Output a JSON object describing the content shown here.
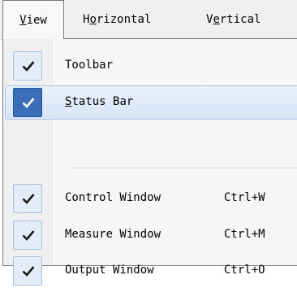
{
  "menubar": {
    "items": [
      {
        "accel": "V",
        "rest": "iew"
      },
      {
        "pre": "H",
        "accel": "o",
        "rest": "rizontal"
      },
      {
        "pre": "V",
        "accel": "e",
        "rest": "rtical"
      }
    ]
  },
  "menu": {
    "items": [
      {
        "label": "Toolbar",
        "checked": true,
        "shortcut": ""
      },
      {
        "accel": "S",
        "rest": "tatus Bar",
        "checked": true,
        "highlighted": true,
        "shortcut": ""
      },
      {
        "label": "Control Window",
        "checked": true,
        "shortcut": "Ctrl+W"
      },
      {
        "label": "Measure Window",
        "checked": true,
        "shortcut": "Ctrl+M"
      },
      {
        "label": "Output Window",
        "checked": true,
        "shortcut": "Ctrl+O"
      }
    ]
  },
  "colors": {
    "highlight_check": "#3a6fb8",
    "check_box": "#e4ecf7",
    "menubar_bg": "#f0f0f0"
  }
}
